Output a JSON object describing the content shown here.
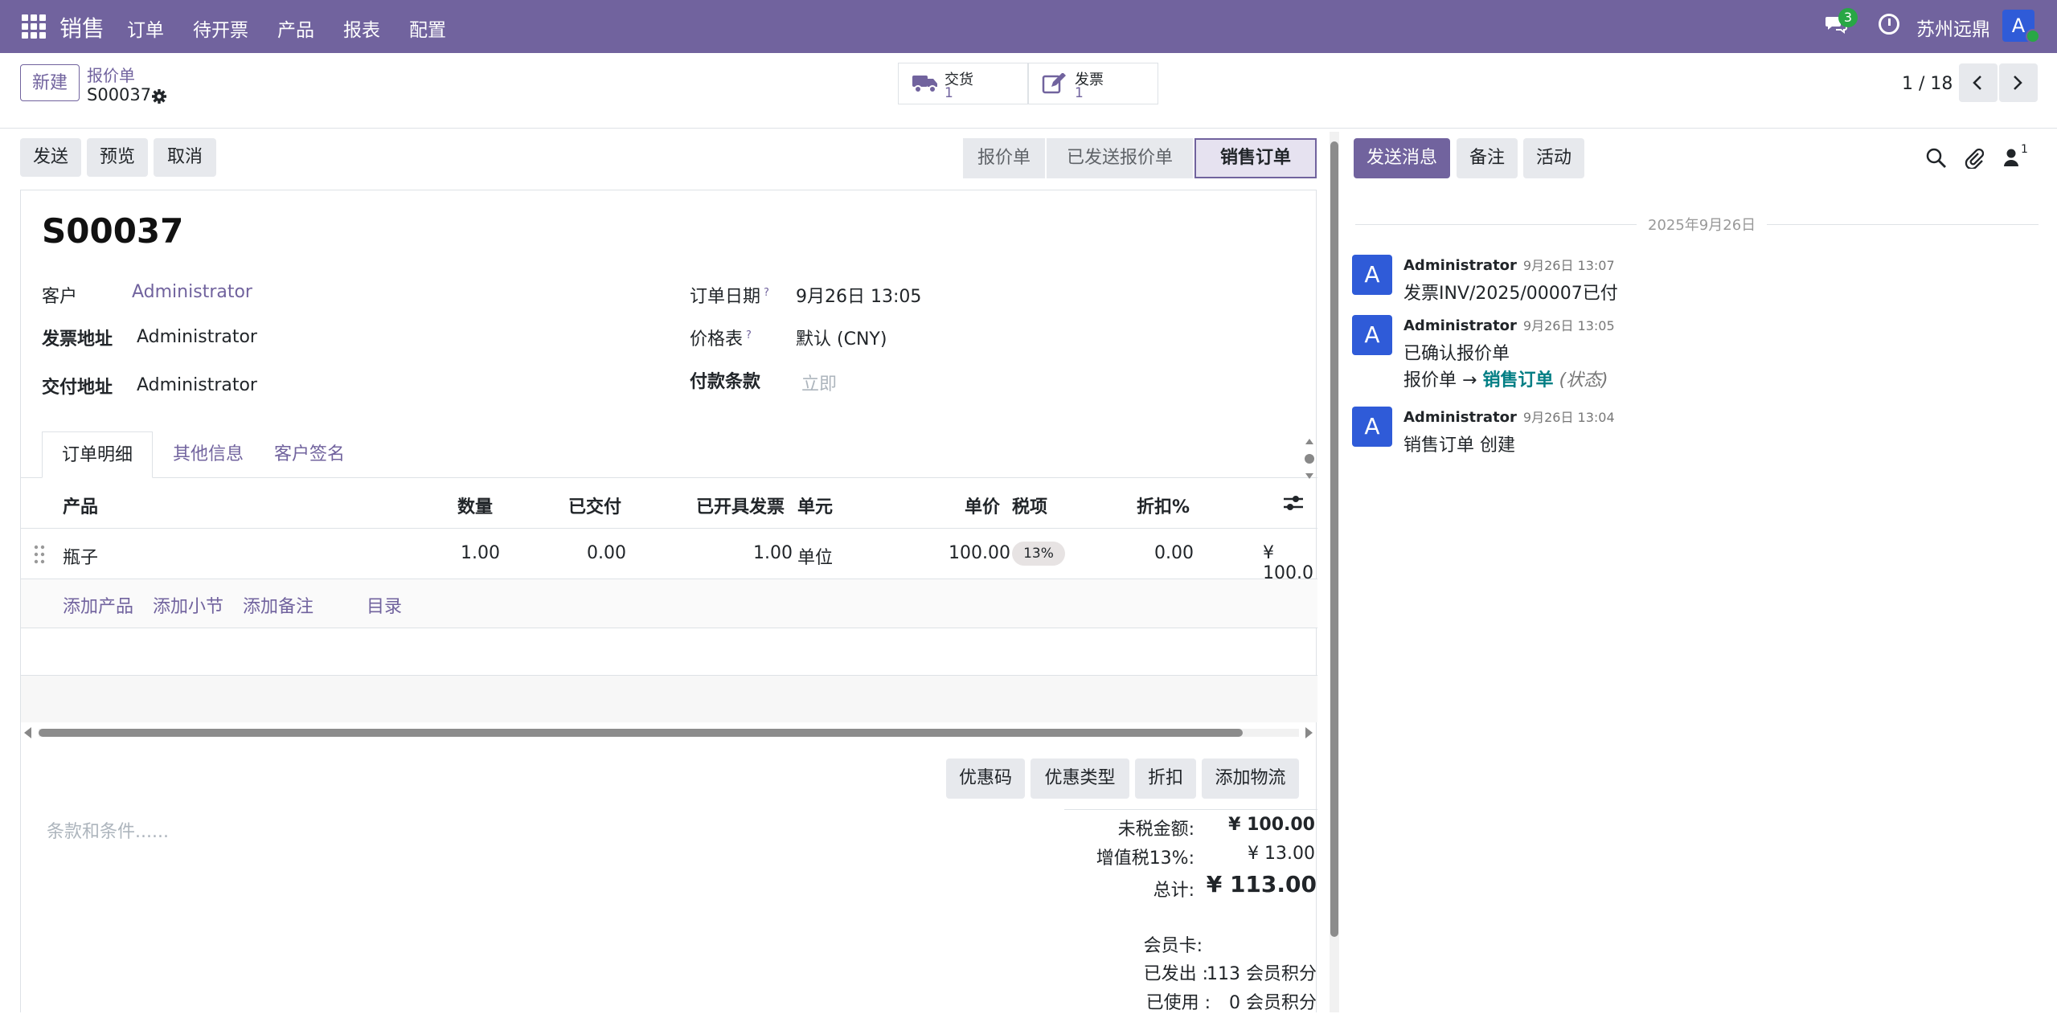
{
  "nav": {
    "app_name": "销售",
    "menu": [
      "订单",
      "待开票",
      "产品",
      "报表",
      "配置"
    ],
    "chat_badge": "3",
    "company": "苏州远鼎",
    "user_initial": "A"
  },
  "control": {
    "new_label": "新建",
    "breadcrumb_parent": "报价单",
    "breadcrumb_current": "S00037",
    "smart_buttons": [
      {
        "label": "交货",
        "count": "1",
        "icon": "truck-icon"
      },
      {
        "label": "发票",
        "count": "1",
        "icon": "edit-icon"
      }
    ],
    "pager": "1 / 18"
  },
  "actions": [
    "发送",
    "预览",
    "取消"
  ],
  "status": {
    "steps": [
      "报价单",
      "已发送报价单",
      "销售订单"
    ],
    "active": "销售订单"
  },
  "form": {
    "title": "S00037",
    "customer_label": "客户",
    "customer": "Administrator",
    "invoice_addr_label": "发票地址",
    "invoice_addr": "Administrator",
    "delivery_addr_label": "交付地址",
    "delivery_addr": "Administrator",
    "order_date_label": "订单日期",
    "order_date": "9月26日 13:05",
    "pricelist_label": "价格表",
    "pricelist": "默认 (CNY)",
    "payment_terms_label": "付款条款",
    "payment_terms_placeholder": "立即",
    "help_mark": "?"
  },
  "tabs": [
    "订单明细",
    "其他信息",
    "客户签名"
  ],
  "table": {
    "headers": {
      "product": "产品",
      "qty": "数量",
      "delivered": "已交付",
      "invoiced": "已开具发票",
      "uom": "单元",
      "price": "单价",
      "tax": "税项",
      "discount": "折扣%"
    },
    "rows": [
      {
        "product": "瓶子",
        "qty": "1.00",
        "delivered": "0.00",
        "invoiced": "1.00",
        "uom": "单位",
        "price": "100.00",
        "tax": "13%",
        "discount": "0.00",
        "subtotal": "¥ 100.0"
      }
    ],
    "add_links": [
      "添加产品",
      "添加小节",
      "添加备注",
      "目录"
    ]
  },
  "promo_buttons": [
    "优惠码",
    "优惠类型",
    "折扣",
    "添加物流"
  ],
  "terms_placeholder": "条款和条件......",
  "totals": {
    "untaxed_label": "未税金额:",
    "untaxed": "¥ 100.00",
    "vat_label": "增值税13%:",
    "vat": "¥ 13.00",
    "total_label": "总计:",
    "total": "¥ 113.00",
    "loyalty_label": "会员卡:",
    "issued_label": "已发出 :",
    "issued": "113 会员积分",
    "used_label": "已使用 :",
    "used": "0 会员积分"
  },
  "chatter": {
    "send_message": "发送消息",
    "log_note": "备注",
    "activity": "活动",
    "followers_count": "1",
    "date_separator": "2025年9月26日",
    "messages": [
      {
        "initial": "A",
        "author": "Administrator",
        "time": "9月26日 13:07",
        "body": "发票INV/2025/00007已付"
      },
      {
        "initial": "A",
        "author": "Administrator",
        "time": "9月26日 13:05",
        "body": "已确认报价单",
        "tracking_old": "报价单",
        "tracking_arrow": "→",
        "tracking_new": "销售订单",
        "tracking_field": "(状态)"
      },
      {
        "initial": "A",
        "author": "Administrator",
        "time": "9月26日 13:04",
        "body": "销售订单 创建"
      }
    ]
  },
  "colors": {
    "brand": "#71639e",
    "avatar": "#2f5bd8",
    "success": "#28a745"
  }
}
